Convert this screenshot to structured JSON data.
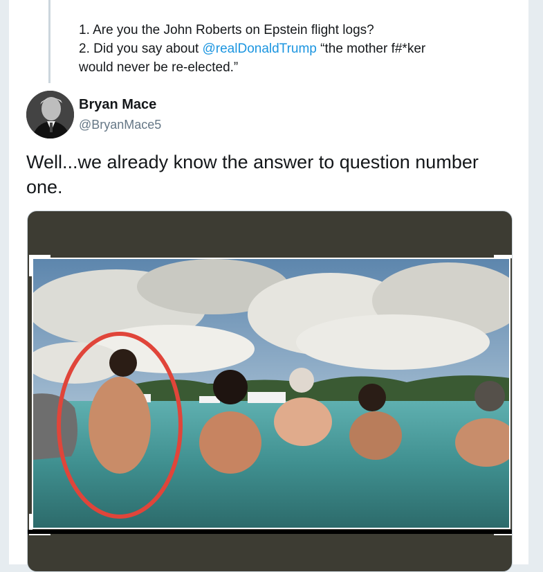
{
  "quoted": {
    "line1": "1. Are you the John Roberts on Epstein flight logs?",
    "line2_prefix": "2. Did you say about ",
    "line2_mention": "@realDonaldTrump",
    "line2_suffix": " “the mother f#*ker",
    "line3": "would never be re-elected.”"
  },
  "author": {
    "name": "Bryan Mace",
    "handle": "@BryanMace5",
    "avatar_icon": "profile-photo"
  },
  "tweet": {
    "text": "Well...we already know the answer to question number one."
  },
  "media": {
    "description_icon": "beach-group-photo",
    "highlight_color": "#e0453a"
  },
  "colors": {
    "mention": "#1b95e0",
    "handle": "#657786",
    "text": "#14171a"
  }
}
